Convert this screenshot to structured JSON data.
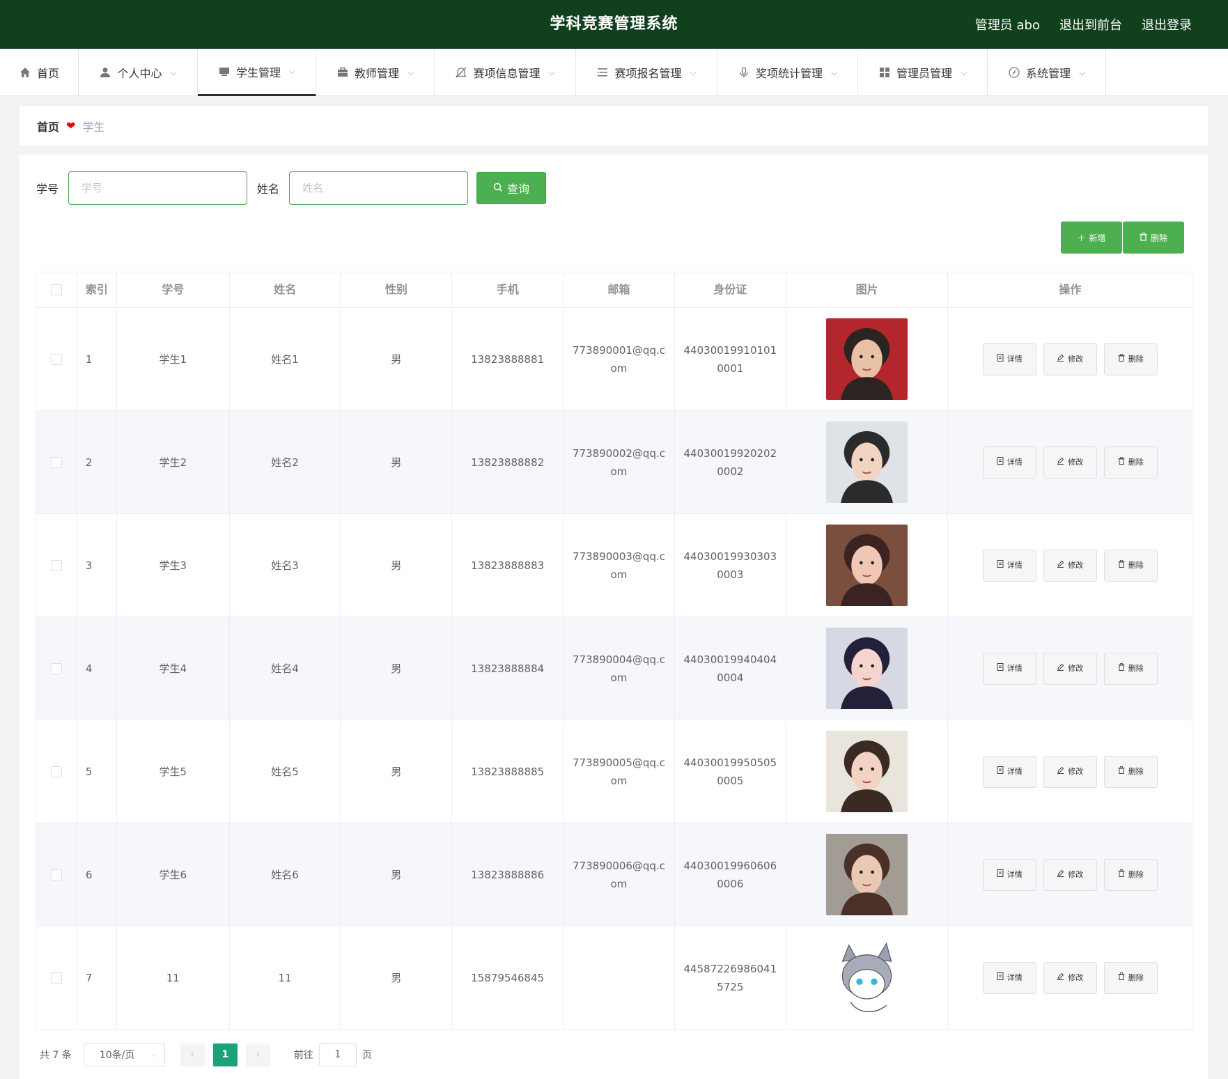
{
  "header": {
    "title": "学科竞赛管理系统",
    "admin_label": "管理员 abo",
    "to_front": "退出到前台",
    "logout": "退出登录"
  },
  "nav": {
    "items": [
      {
        "label": "首页",
        "icon": "home-icon"
      },
      {
        "label": "个人中心",
        "icon": "user-icon"
      },
      {
        "label": "学生管理",
        "icon": "monitor-icon"
      },
      {
        "label": "教师管理",
        "icon": "briefcase-icon"
      },
      {
        "label": "赛项信息管理",
        "icon": "bell-off-icon"
      },
      {
        "label": "赛项报名管理",
        "icon": "list-icon"
      },
      {
        "label": "奖项统计管理",
        "icon": "microphone-icon"
      },
      {
        "label": "管理员管理",
        "icon": "grid-icon"
      },
      {
        "label": "系统管理",
        "icon": "compass-icon"
      }
    ],
    "active": "学生管理"
  },
  "breadcrumb": {
    "home": "首页",
    "current": "学生"
  },
  "search": {
    "id_label": "学号",
    "id_placeholder": "学号",
    "name_label": "姓名",
    "name_placeholder": "姓名",
    "query_button": "查询"
  },
  "toolbar": {
    "add": "新增",
    "delete": "删除"
  },
  "table": {
    "columns": [
      "索引",
      "学号",
      "姓名",
      "性别",
      "手机",
      "邮箱",
      "身份证",
      "图片",
      "操作"
    ],
    "rows": [
      {
        "index": "1",
        "id": "学生1",
        "name": "姓名1",
        "gender": "男",
        "phone": "13823888881",
        "email": "773890001@qq.com",
        "idcard": "440300199101010001"
      },
      {
        "index": "2",
        "id": "学生2",
        "name": "姓名2",
        "gender": "男",
        "phone": "13823888882",
        "email": "773890002@qq.com",
        "idcard": "440300199202020002"
      },
      {
        "index": "3",
        "id": "学生3",
        "name": "姓名3",
        "gender": "男",
        "phone": "13823888883",
        "email": "773890003@qq.com",
        "idcard": "440300199303030003"
      },
      {
        "index": "4",
        "id": "学生4",
        "name": "姓名4",
        "gender": "男",
        "phone": "13823888884",
        "email": "773890004@qq.com",
        "idcard": "440300199404040004"
      },
      {
        "index": "5",
        "id": "学生5",
        "name": "姓名5",
        "gender": "男",
        "phone": "13823888885",
        "email": "773890005@qq.com",
        "idcard": "440300199505050005"
      },
      {
        "index": "6",
        "id": "学生6",
        "name": "姓名6",
        "gender": "男",
        "phone": "13823888886",
        "email": "773890006@qq.com",
        "idcard": "440300199606060006"
      },
      {
        "index": "7",
        "id": "11",
        "name": "11",
        "gender": "男",
        "phone": "15879546845",
        "email": "",
        "idcard": "445872269860415725"
      }
    ],
    "actions": {
      "detail": "详情",
      "edit": "修改",
      "delete": "删除"
    }
  },
  "pagination": {
    "total": "共 7 条",
    "page_size": "10条/页",
    "current_page": "1",
    "goto_label": "前往",
    "goto_value": "1",
    "page_suffix": "页"
  },
  "colors": {
    "header_bg": "#11401d",
    "primary_green": "#4caf50",
    "page_active": "#1ba27a"
  }
}
